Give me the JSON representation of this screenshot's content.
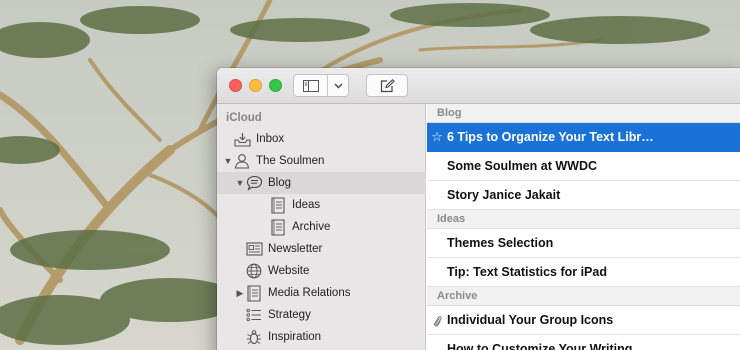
{
  "sidebar": {
    "header": "iCloud",
    "items": [
      {
        "label": "Inbox"
      },
      {
        "label": "The Soulmen"
      },
      {
        "label": "Blog"
      },
      {
        "label": "Ideas"
      },
      {
        "label": "Archive"
      },
      {
        "label": "Newsletter"
      },
      {
        "label": "Website"
      },
      {
        "label": "Media Relations"
      },
      {
        "label": "Strategy"
      },
      {
        "label": "Inspiration"
      }
    ]
  },
  "list": {
    "groups": [
      {
        "header": "Blog",
        "rows": [
          {
            "mark": "☆",
            "title": "6 Tips to Organize Your Text Libr…"
          },
          {
            "title": "Some Soulmen at WWDC"
          },
          {
            "title": "Story Janice Jakait"
          }
        ]
      },
      {
        "header": "Ideas",
        "rows": [
          {
            "title": "Themes Selection"
          },
          {
            "title": "Tip: Text Statistics for iPad"
          }
        ]
      },
      {
        "header": "Archive",
        "rows": [
          {
            "title": "Individual Your Group Icons"
          },
          {
            "title": "How to Customize Your Writing"
          }
        ]
      }
    ]
  },
  "colors": {
    "selection": "#1a72d6",
    "sidebar_bg": "#e8e6e6",
    "close": "#fc605c",
    "minimize": "#fdbc40",
    "maximize": "#34c84a"
  }
}
